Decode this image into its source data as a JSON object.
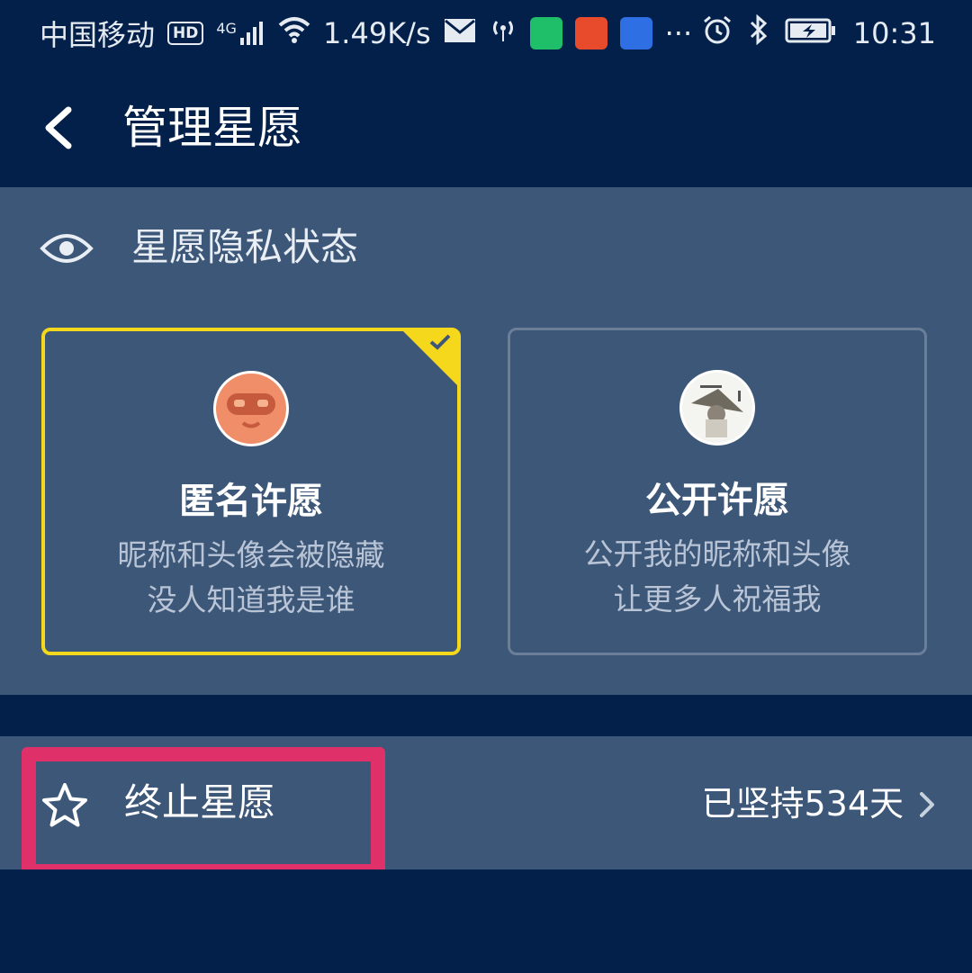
{
  "status_bar": {
    "carrier": "中国移动",
    "hd": "HD",
    "network": "4G",
    "speed": "1.49K/s",
    "more": "···",
    "time": "10:31"
  },
  "header": {
    "title": "管理星愿",
    "back_icon": "chevron-left-icon"
  },
  "privacy": {
    "section_title": "星愿隐私状态",
    "icon": "eye-icon",
    "options": [
      {
        "title": "匿名许愿",
        "desc_line1": "昵称和头像会被隐藏",
        "desc_line2": "没人知道我是谁",
        "selected": true
      },
      {
        "title": "公开许愿",
        "desc_line1": "公开我的昵称和头像",
        "desc_line2": "让更多人祝福我",
        "selected": false
      }
    ]
  },
  "terminate": {
    "label": "终止星愿",
    "days": "已坚持534天",
    "icon": "star-icon"
  },
  "colors": {
    "background": "#03204a",
    "panel": "#3d5778",
    "selected_border": "#f5d81c",
    "highlight": "#e0306a"
  }
}
